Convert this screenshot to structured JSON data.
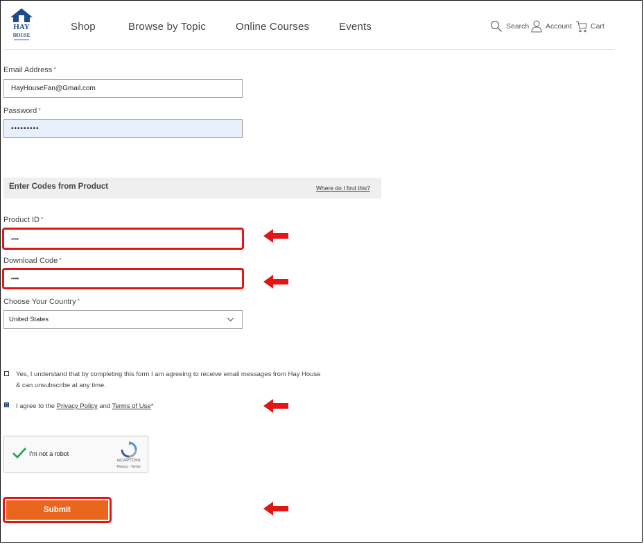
{
  "header": {
    "logo": {
      "line1": "HAY",
      "line2": "HOUSE",
      "color": "#1f4a8f"
    },
    "nav": [
      {
        "label": "Shop"
      },
      {
        "label": "Browse by Topic"
      },
      {
        "label": "Online Courses"
      },
      {
        "label": "Events"
      }
    ],
    "utilities": {
      "search": {
        "label": "Search",
        "icon": "search-icon"
      },
      "account": {
        "label": "Account",
        "icon": "user-icon"
      },
      "cart": {
        "label": "Cart",
        "icon": "cart-icon"
      }
    }
  },
  "form": {
    "email": {
      "label": "Email Address",
      "required_mark": "*",
      "value": "HayHouseFan@Gmail.com"
    },
    "password": {
      "label": "Password",
      "required_mark": "*",
      "value": "•••••••••"
    },
    "codes_section": {
      "title": "Enter Codes from Product",
      "help_link": "Where do I find this?"
    },
    "product_id": {
      "label": "Product ID",
      "required_mark": "*",
      "value": "••••"
    },
    "download_code": {
      "label": "Download Code",
      "required_mark": "*",
      "value": "••••"
    },
    "country": {
      "label": "Choose Your Country",
      "required_mark": "*",
      "selected": "United States"
    },
    "email_opt_in": {
      "checked": false,
      "text": "Yes, I understand that by completing this form I am agreeing to receive email messages from Hay House & can unsubscribe at any time."
    },
    "terms": {
      "checked": true,
      "prefix": "I agree to the ",
      "privacy_link": "Privacy Policy",
      "middle": " and ",
      "terms_link": "Terms of Use",
      "suffix": "*"
    },
    "captcha": {
      "label": "I'm not a robot",
      "brand": "reCAPTCHA",
      "links": "Privacy - Terms"
    },
    "submit": {
      "label": "Submit",
      "color": "#e8661e"
    }
  },
  "annotations": {
    "highlight_color": "#e31616"
  }
}
